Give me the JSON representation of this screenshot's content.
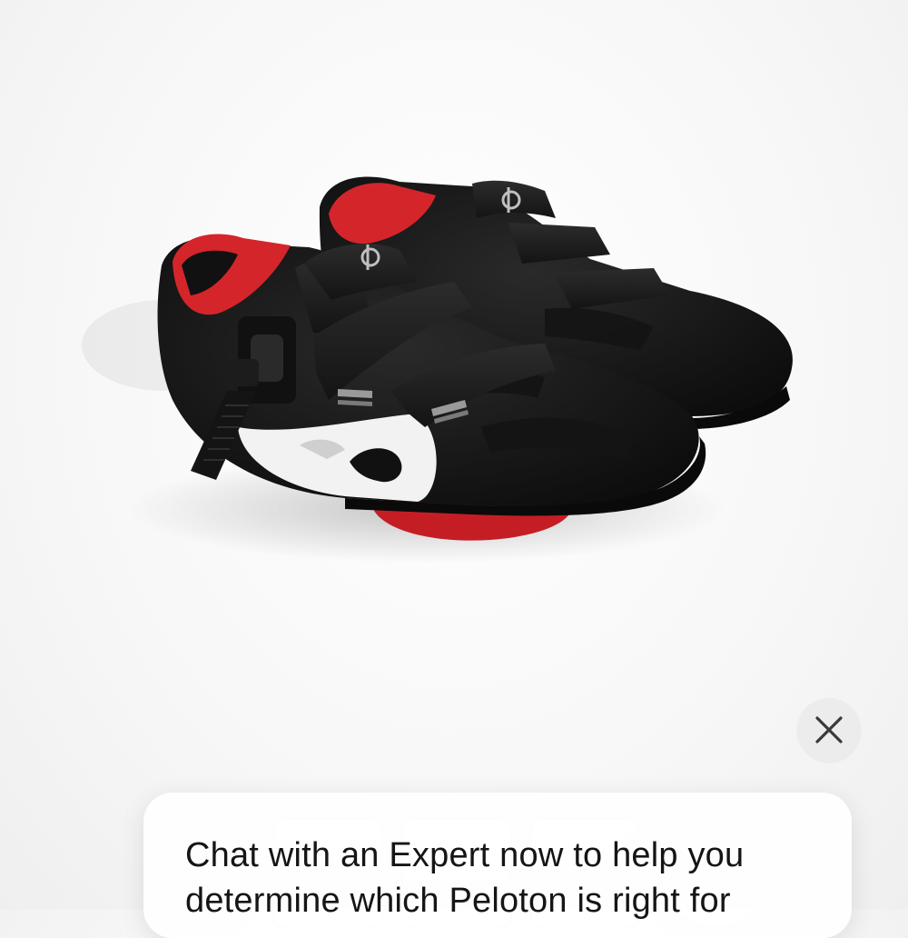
{
  "product": {
    "icon": "cycling-shoes-image",
    "colors": {
      "shoe": "#1a1a1a",
      "accent": "#d4252b",
      "sole_white": "#f2f2f2"
    }
  },
  "close_button": {
    "icon": "close-icon"
  },
  "chat_prompt": {
    "message": "Chat with an Expert now to help you determine which Peloton is right for"
  },
  "thumbnails": {
    "icons": [
      "thumbnail-1",
      "thumbnail-2",
      "thumbnail-3",
      "thumbnail-4"
    ]
  }
}
